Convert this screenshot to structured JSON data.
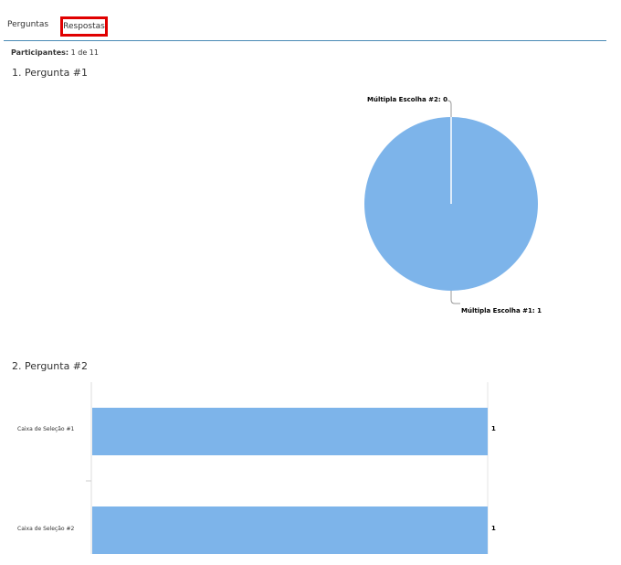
{
  "tabs": {
    "perguntas": "Perguntas",
    "respostas": "Respostas"
  },
  "participants": {
    "label": "Participantes:",
    "value": "1 de 11"
  },
  "questions": [
    {
      "title": "1. Pergunta #1"
    },
    {
      "title": "2. Pergunta #2"
    }
  ],
  "colors": {
    "bar": "#7db4ea",
    "highlight": "#e00000",
    "tab_border": "#4a8ab5"
  },
  "chart_data": [
    {
      "type": "pie",
      "slices": [
        {
          "label": "Múltipla Escolha #1: 1",
          "name": "Múltipla Escolha #1",
          "value": 1
        },
        {
          "label": "Múltipla Escolha #2: 0",
          "name": "Múltipla Escolha #2",
          "value": 0
        }
      ]
    },
    {
      "type": "bar",
      "orientation": "horizontal",
      "categories": [
        "Caixa de Seleção #1",
        "Caixa de Seleção #2"
      ],
      "values": [
        1,
        1
      ],
      "value_labels": [
        "1",
        "1"
      ]
    }
  ]
}
